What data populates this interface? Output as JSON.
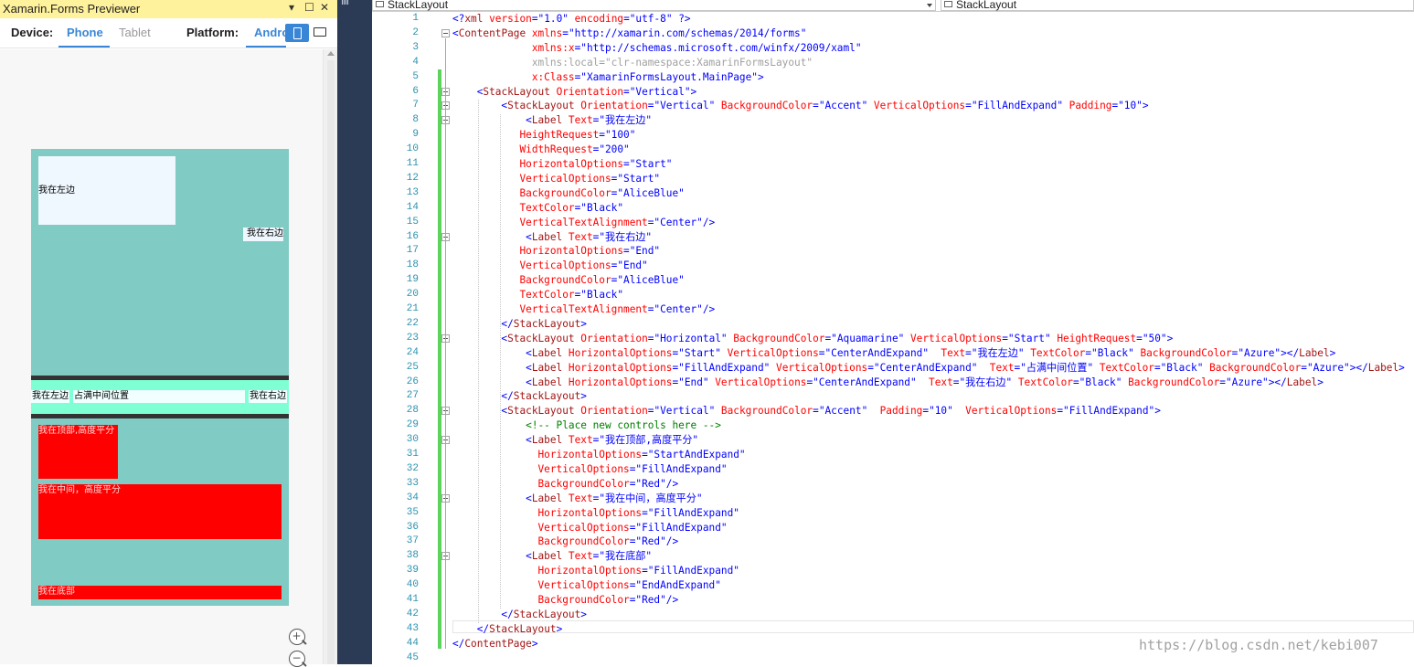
{
  "previewer": {
    "title": "Xamarin.Forms Previewer",
    "title_controls": {
      "dropdown": "▾",
      "maximize": "☐",
      "close": "✕"
    },
    "device_label": "Device:",
    "device_tabs": [
      "Phone",
      "Tablet"
    ],
    "platform_label": "Platform:",
    "platform_value": "Andro",
    "zoom_in": "+",
    "zoom_out": "−",
    "icons": [
      "phone-icon",
      "tablet-icon",
      "zoom-in-icon",
      "zoom-out-icon"
    ],
    "accent_color": "#3a86d6"
  },
  "preview": {
    "left_label": "我在左边",
    "right_label": "我在右边",
    "h_left": "我在左边",
    "h_mid": "占满中间位置",
    "h_right": "我在右边",
    "red_top": "我在顶部,高度平分",
    "red_mid": "我在中间，高度平分",
    "red_bottom": "我在底部",
    "colors": {
      "accent": "#80cbc4",
      "aliceblue": "#f0f8ff",
      "aquamarine": "#7fffd4",
      "azure": "#f0ffff",
      "red": "#ff0000"
    }
  },
  "editor": {
    "nav_left": "StackLayout",
    "nav_right": "StackLayout",
    "line_numbers": [
      "1",
      "2",
      "3",
      "4",
      "5",
      "6",
      "7",
      "8",
      "9",
      "10",
      "11",
      "12",
      "13",
      "14",
      "15",
      "16",
      "17",
      "18",
      "19",
      "20",
      "21",
      "22",
      "23",
      "24",
      "25",
      "26",
      "27",
      "28",
      "29",
      "30",
      "31",
      "32",
      "33",
      "34",
      "35",
      "36",
      "37",
      "38",
      "39",
      "40",
      "41",
      "42",
      "43",
      "44",
      "45"
    ],
    "code_lines": [
      [
        [
          "b",
          "<?"
        ],
        [
          "m",
          "xml"
        ],
        [
          "r",
          " version"
        ],
        [
          "b",
          "="
        ],
        [
          "ab",
          "\"1.0\""
        ],
        [
          "r",
          " encoding"
        ],
        [
          "b",
          "="
        ],
        [
          "ab",
          "\"utf-8\""
        ],
        [
          "b",
          " ?>"
        ]
      ],
      [
        [
          "b",
          "<"
        ],
        [
          "m",
          "ContentPage"
        ],
        [
          "r",
          " xmlns"
        ],
        [
          "b",
          "="
        ],
        [
          "ab",
          "\"http://xamarin.com/schemas/2014/forms\""
        ]
      ],
      [
        [
          "r",
          "             xmlns:x"
        ],
        [
          "b",
          "="
        ],
        [
          "ab",
          "\"http://schemas.microsoft.com/winfx/2009/xaml\""
        ]
      ],
      [
        [
          "x",
          "             xmlns:local=\"clr-namespace:XamarinFormsLayout\""
        ]
      ],
      [
        [
          "r",
          "             x:Class"
        ],
        [
          "b",
          "="
        ],
        [
          "ab",
          "\"XamarinFormsLayout.MainPage\""
        ],
        [
          "b",
          ">"
        ]
      ],
      [
        [
          "b",
          "    <"
        ],
        [
          "m",
          "StackLayout"
        ],
        [
          "r",
          " Orientation"
        ],
        [
          "b",
          "="
        ],
        [
          "ab",
          "\"Vertical\""
        ],
        [
          "b",
          ">"
        ]
      ],
      [
        [
          "b",
          "        <"
        ],
        [
          "m",
          "StackLayout"
        ],
        [
          "r",
          " Orientation"
        ],
        [
          "b",
          "="
        ],
        [
          "ab",
          "\"Vertical\""
        ],
        [
          "r",
          " BackgroundColor"
        ],
        [
          "b",
          "="
        ],
        [
          "ab",
          "\"Accent\""
        ],
        [
          "r",
          " VerticalOptions"
        ],
        [
          "b",
          "="
        ],
        [
          "ab",
          "\"FillAndExpand\""
        ],
        [
          "r",
          " Padding"
        ],
        [
          "b",
          "="
        ],
        [
          "ab",
          "\"10\""
        ],
        [
          "b",
          ">"
        ]
      ],
      [
        [
          "b",
          "            <"
        ],
        [
          "m",
          "Label"
        ],
        [
          "r",
          " Text"
        ],
        [
          "b",
          "="
        ],
        [
          "ab",
          "\"我在左边\""
        ]
      ],
      [
        [
          "r",
          "           HeightRequest"
        ],
        [
          "b",
          "="
        ],
        [
          "ab",
          "\"100\""
        ]
      ],
      [
        [
          "r",
          "           WidthRequest"
        ],
        [
          "b",
          "="
        ],
        [
          "ab",
          "\"200\""
        ]
      ],
      [
        [
          "r",
          "           HorizontalOptions"
        ],
        [
          "b",
          "="
        ],
        [
          "ab",
          "\"Start\""
        ]
      ],
      [
        [
          "r",
          "           VerticalOptions"
        ],
        [
          "b",
          "="
        ],
        [
          "ab",
          "\"Start\""
        ]
      ],
      [
        [
          "r",
          "           BackgroundColor"
        ],
        [
          "b",
          "="
        ],
        [
          "ab",
          "\"AliceBlue\""
        ]
      ],
      [
        [
          "r",
          "           TextColor"
        ],
        [
          "b",
          "="
        ],
        [
          "ab",
          "\"Black\""
        ]
      ],
      [
        [
          "r",
          "           VerticalTextAlignment"
        ],
        [
          "b",
          "="
        ],
        [
          "ab",
          "\"Center\""
        ],
        [
          "b",
          "/>"
        ]
      ],
      [
        [
          "b",
          "            <"
        ],
        [
          "m",
          "Label"
        ],
        [
          "r",
          " Text"
        ],
        [
          "b",
          "="
        ],
        [
          "ab",
          "\"我在右边\""
        ]
      ],
      [
        [
          "r",
          "           HorizontalOptions"
        ],
        [
          "b",
          "="
        ],
        [
          "ab",
          "\"End\""
        ]
      ],
      [
        [
          "r",
          "           VerticalOptions"
        ],
        [
          "b",
          "="
        ],
        [
          "ab",
          "\"End\""
        ]
      ],
      [
        [
          "r",
          "           BackgroundColor"
        ],
        [
          "b",
          "="
        ],
        [
          "ab",
          "\"AliceBlue\""
        ]
      ],
      [
        [
          "r",
          "           TextColor"
        ],
        [
          "b",
          "="
        ],
        [
          "ab",
          "\"Black\""
        ]
      ],
      [
        [
          "r",
          "           VerticalTextAlignment"
        ],
        [
          "b",
          "="
        ],
        [
          "ab",
          "\"Center\""
        ],
        [
          "b",
          "/>"
        ]
      ],
      [
        [
          "b",
          "        </"
        ],
        [
          "m",
          "StackLayout"
        ],
        [
          "b",
          ">"
        ]
      ],
      [
        [
          "b",
          "        <"
        ],
        [
          "m",
          "StackLayout"
        ],
        [
          "r",
          " Orientation"
        ],
        [
          "b",
          "="
        ],
        [
          "ab",
          "\"Horizontal\""
        ],
        [
          "r",
          " BackgroundColor"
        ],
        [
          "b",
          "="
        ],
        [
          "ab",
          "\"Aquamarine\""
        ],
        [
          "r",
          " VerticalOptions"
        ],
        [
          "b",
          "="
        ],
        [
          "ab",
          "\"Start\""
        ],
        [
          "r",
          " HeightRequest"
        ],
        [
          "b",
          "="
        ],
        [
          "ab",
          "\"50\""
        ],
        [
          "b",
          ">"
        ]
      ],
      [
        [
          "b",
          "            <"
        ],
        [
          "m",
          "Label"
        ],
        [
          "r",
          " HorizontalOptions"
        ],
        [
          "b",
          "="
        ],
        [
          "ab",
          "\"Start\""
        ],
        [
          "r",
          " VerticalOptions"
        ],
        [
          "b",
          "="
        ],
        [
          "ab",
          "\"CenterAndExpand\""
        ],
        [
          "r",
          "  Text"
        ],
        [
          "b",
          "="
        ],
        [
          "ab",
          "\"我在左边\""
        ],
        [
          "r",
          " TextColor"
        ],
        [
          "b",
          "="
        ],
        [
          "ab",
          "\"Black\""
        ],
        [
          "r",
          " BackgroundColor"
        ],
        [
          "b",
          "="
        ],
        [
          "ab",
          "\"Azure\""
        ],
        [
          "b",
          "></"
        ],
        [
          "m",
          "Label"
        ],
        [
          "b",
          ">"
        ]
      ],
      [
        [
          "b",
          "            <"
        ],
        [
          "m",
          "Label"
        ],
        [
          "r",
          " HorizontalOptions"
        ],
        [
          "b",
          "="
        ],
        [
          "ab",
          "\"FillAndExpand\""
        ],
        [
          "r",
          " VerticalOptions"
        ],
        [
          "b",
          "="
        ],
        [
          "ab",
          "\"CenterAndExpand\""
        ],
        [
          "r",
          "  Text"
        ],
        [
          "b",
          "="
        ],
        [
          "ab",
          "\"占满中间位置\""
        ],
        [
          "r",
          " TextColor"
        ],
        [
          "b",
          "="
        ],
        [
          "ab",
          "\"Black\""
        ],
        [
          "r",
          " BackgroundColor"
        ],
        [
          "b",
          "="
        ],
        [
          "ab",
          "\"Azure\""
        ],
        [
          "b",
          "></"
        ],
        [
          "m",
          "Label"
        ],
        [
          "b",
          ">"
        ]
      ],
      [
        [
          "b",
          "            <"
        ],
        [
          "m",
          "Label"
        ],
        [
          "r",
          " HorizontalOptions"
        ],
        [
          "b",
          "="
        ],
        [
          "ab",
          "\"End\""
        ],
        [
          "r",
          " VerticalOptions"
        ],
        [
          "b",
          "="
        ],
        [
          "ab",
          "\"CenterAndExpand\""
        ],
        [
          "r",
          "  Text"
        ],
        [
          "b",
          "="
        ],
        [
          "ab",
          "\"我在右边\""
        ],
        [
          "r",
          " TextColor"
        ],
        [
          "b",
          "="
        ],
        [
          "ab",
          "\"Black\""
        ],
        [
          "r",
          " BackgroundColor"
        ],
        [
          "b",
          "="
        ],
        [
          "ab",
          "\"Azure\""
        ],
        [
          "b",
          "></"
        ],
        [
          "m",
          "Label"
        ],
        [
          "b",
          ">"
        ]
      ],
      [
        [
          "b",
          "        </"
        ],
        [
          "m",
          "StackLayout"
        ],
        [
          "b",
          ">"
        ]
      ],
      [
        [
          "b",
          "        <"
        ],
        [
          "m",
          "StackLayout"
        ],
        [
          "r",
          " Orientation"
        ],
        [
          "b",
          "="
        ],
        [
          "ab",
          "\"Vertical\""
        ],
        [
          "r",
          " BackgroundColor"
        ],
        [
          "b",
          "="
        ],
        [
          "ab",
          "\"Accent\""
        ],
        [
          "r",
          "  Padding"
        ],
        [
          "b",
          "="
        ],
        [
          "ab",
          "\"10\""
        ],
        [
          "r",
          "  VerticalOptions"
        ],
        [
          "b",
          "="
        ],
        [
          "ab",
          "\"FillAndExpand\""
        ],
        [
          "b",
          ">"
        ]
      ],
      [
        [
          "g",
          "            <!-- Place new controls here -->"
        ]
      ],
      [
        [
          "b",
          "            <"
        ],
        [
          "m",
          "Label"
        ],
        [
          "r",
          " Text"
        ],
        [
          "b",
          "="
        ],
        [
          "ab",
          "\"我在顶部,高度平分\""
        ]
      ],
      [
        [
          "r",
          "              HorizontalOptions"
        ],
        [
          "b",
          "="
        ],
        [
          "ab",
          "\"StartAndExpand\""
        ]
      ],
      [
        [
          "r",
          "              VerticalOptions"
        ],
        [
          "b",
          "="
        ],
        [
          "ab",
          "\"FillAndExpand\""
        ]
      ],
      [
        [
          "r",
          "              BackgroundColor"
        ],
        [
          "b",
          "="
        ],
        [
          "ab",
          "\"Red\""
        ],
        [
          "b",
          "/>"
        ]
      ],
      [
        [
          "b",
          "            <"
        ],
        [
          "m",
          "Label"
        ],
        [
          "r",
          " Text"
        ],
        [
          "b",
          "="
        ],
        [
          "ab",
          "\"我在中间，高度平分\""
        ]
      ],
      [
        [
          "r",
          "              HorizontalOptions"
        ],
        [
          "b",
          "="
        ],
        [
          "ab",
          "\"FillAndExpand\""
        ]
      ],
      [
        [
          "r",
          "              VerticalOptions"
        ],
        [
          "b",
          "="
        ],
        [
          "ab",
          "\"FillAndExpand\""
        ]
      ],
      [
        [
          "r",
          "              BackgroundColor"
        ],
        [
          "b",
          "="
        ],
        [
          "ab",
          "\"Red\""
        ],
        [
          "b",
          "/>"
        ]
      ],
      [
        [
          "b",
          "            <"
        ],
        [
          "m",
          "Label"
        ],
        [
          "r",
          " Text"
        ],
        [
          "b",
          "="
        ],
        [
          "ab",
          "\"我在底部\""
        ]
      ],
      [
        [
          "r",
          "              HorizontalOptions"
        ],
        [
          "b",
          "="
        ],
        [
          "ab",
          "\"FillAndExpand\""
        ]
      ],
      [
        [
          "r",
          "              VerticalOptions"
        ],
        [
          "b",
          "="
        ],
        [
          "ab",
          "\"EndAndExpand\""
        ]
      ],
      [
        [
          "r",
          "              BackgroundColor"
        ],
        [
          "b",
          "="
        ],
        [
          "ab",
          "\"Red\""
        ],
        [
          "b",
          "/>"
        ]
      ],
      [
        [
          "b",
          "        </"
        ],
        [
          "m",
          "StackLayout"
        ],
        [
          "b",
          ">"
        ]
      ],
      [
        [
          "b",
          "    </"
        ],
        [
          "m",
          "StackLayout"
        ],
        [
          "b",
          ">"
        ]
      ],
      [
        [
          "b",
          "</"
        ],
        [
          "m",
          "ContentPage"
        ],
        [
          "b",
          ">"
        ]
      ],
      []
    ],
    "syntax_colors": {
      "b": "#0000ff",
      "r": "#ff0000",
      "m": "#a31515",
      "g": "#008000",
      "x": "#a0a0a0"
    }
  },
  "watermark": "https://blog.csdn.net/kebi007"
}
